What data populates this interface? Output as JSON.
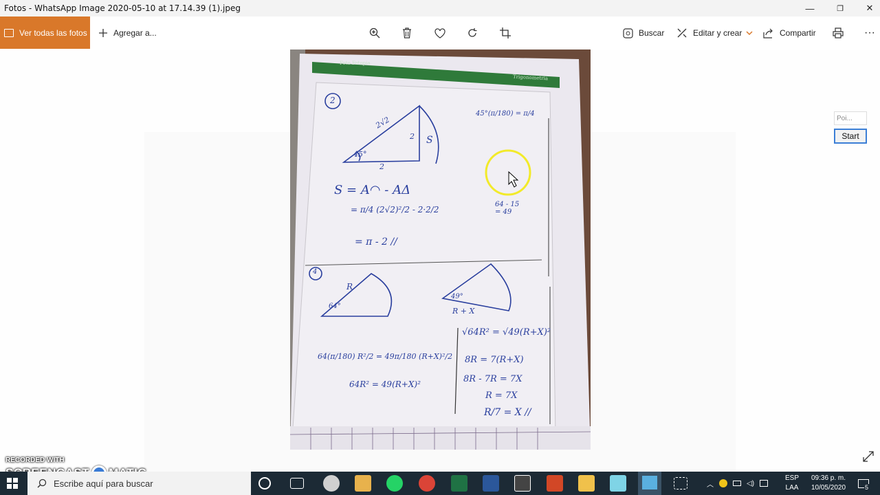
{
  "window": {
    "title": "Fotos - WhatsApp Image 2020-05-10 at 17.14.39 (1).jpeg",
    "minimize_glyph": "—",
    "restore_glyph": "❐",
    "close_glyph": "✕"
  },
  "toolbar": {
    "all_photos_label": "Ver todas las fotos",
    "add_label": "Agregar a...",
    "search_label": "Buscar",
    "edit_create_label": "Editar y crear",
    "share_label": "Compartir",
    "more_glyph": "···",
    "icons": [
      "zoom-in-icon",
      "delete-icon",
      "heart-icon",
      "rotate-icon",
      "crop-icon",
      "search-visual-icon",
      "edit-icon",
      "share-icon",
      "print-icon"
    ],
    "accent_color": "#d9782a"
  },
  "side_widget": {
    "input_placeholder": "Poi...",
    "start_label": "Start"
  },
  "photo": {
    "book_header_left": "Foto Fotopia",
    "book_header_right": "Trigonometria",
    "problem_2_number": "2",
    "side_hyp": "2√2",
    "side_vert": "2",
    "side_base": "2",
    "angle_45": "45°",
    "area_label": "S",
    "conversion": "45°(π/180) = π/4",
    "eq1": "S = A◠ - AΔ",
    "eq2": "= π/4 (2√2)²/2 - 2·2/2",
    "eq3": "= π - 2 //",
    "calc_right": "64 - 15 = 49",
    "problem_4_number": "4",
    "sector1_R": "R",
    "sector1_angle": "64°",
    "sector2_angle": "49°",
    "sector2_label": "R + X",
    "eq4": "64(π/180) R²/2 = 49π/180 (R+X)²/2",
    "eq5": "64R² = 49(R+X)²",
    "eq6": "√64R² = √49(R+X)²",
    "eq7": "8R = 7(R+X)",
    "eq8": "8R - 7R = 7X",
    "eq9": "R = 7X",
    "eq10": "R/7 = X //",
    "ink_color": "#2a3f9e",
    "green_header": "#2f7a3a"
  },
  "cursor_highlight_color": "#f2ea2a",
  "watermark": {
    "recorded_with": "RECORDED WITH",
    "brand_left": "SCREENCAST",
    "brand_right": "MATIC"
  },
  "taskbar": {
    "search_placeholder": "Escribe aquí para buscar",
    "apps": [
      "cortana-icon",
      "task-view-icon",
      "chrome-icon",
      "paint-icon",
      "whatsapp-icon",
      "chrome-browser-icon",
      "excel-icon",
      "word-icon",
      "calculator-icon",
      "powerpoint-icon",
      "file-explorer-icon",
      "notepad-icon",
      "photos-icon",
      "snip-icon"
    ],
    "lang_top": "ESP",
    "lang_bottom": "LAA",
    "time": "09:36 p. m.",
    "date": "10/05/2020",
    "notification_count": "5",
    "bg_color": "#1c2a35"
  }
}
